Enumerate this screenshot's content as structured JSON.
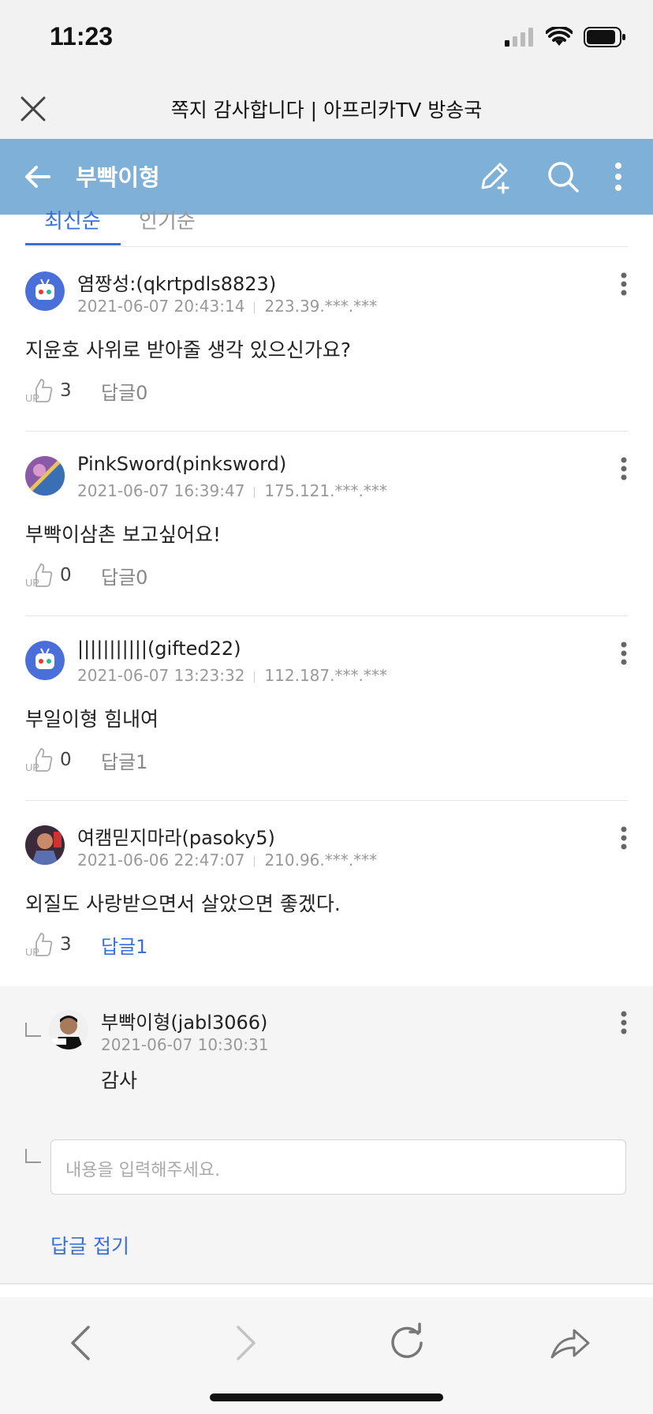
{
  "status_bar": {
    "time": "11:23"
  },
  "browser": {
    "title": "쪽지 감사합니다 | 아프리카TV 방송국"
  },
  "header": {
    "title": "부빡이형",
    "color": "#7fb0d8"
  },
  "tabs": [
    {
      "label": "최신순",
      "active": true
    },
    {
      "label": "인기순",
      "active": false
    }
  ],
  "comments": [
    {
      "author": "염짱성:(qkrtpdls8823)",
      "date": "2021-06-07 20:43:14",
      "ip": "223.39.***.***",
      "text": "지윤호 사위로 받아줄 생각 있으신가요?",
      "likes": "3",
      "reply": "답글0"
    },
    {
      "author": "PinkSword(pinksword)",
      "date": "2021-06-07 16:39:47",
      "ip": "175.121.***.***",
      "text": "부빡이삼촌 보고싶어요!",
      "likes": "0",
      "reply": "답글0"
    },
    {
      "author": "|||||||||||(gifted22)",
      "date": "2021-06-07 13:23:32",
      "ip": "112.187.***.***",
      "text": "부일이형 힘내여",
      "likes": "0",
      "reply": "답글1"
    },
    {
      "author": "여캠믿지마라(pasoky5)",
      "date": "2021-06-06 22:47:07",
      "ip": "210.96.***.***",
      "text": "외질도 사랑받으면서 살았으면 좋겠다.",
      "likes": "3",
      "reply": "답글1"
    }
  ],
  "reply": {
    "author": "부빡이형(jabl3066)",
    "date": "2021-06-07 10:30:31",
    "text": "감사"
  },
  "reply_input": {
    "placeholder": "내용을 입력해주세요."
  },
  "reply_fold": "답글 접기",
  "colors": {
    "accent": "#3b6fd8",
    "header": "#7fb0d8"
  }
}
